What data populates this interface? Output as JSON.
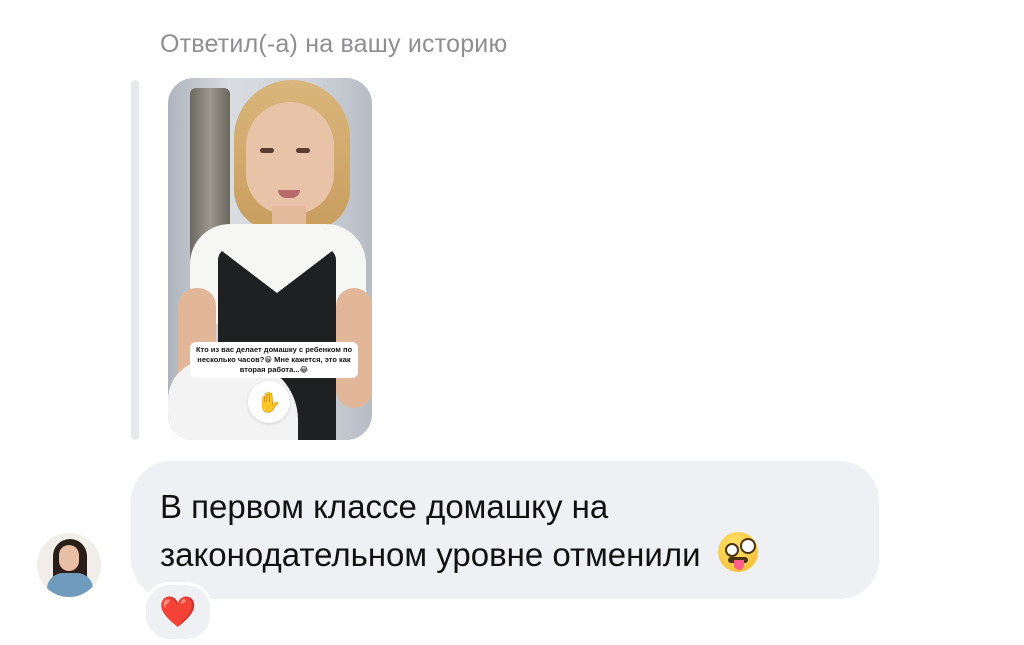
{
  "reply_header": "Ответил(-а) на вашу историю",
  "story": {
    "caption": "Кто из вас делает домашку с ребенком по несколько часов?😁 Мне кажется, это как вторая работа...😂",
    "reaction_icon": "✋"
  },
  "message": {
    "text": "В первом классе домашку на законодательном уровне отменили",
    "emoji": "zany-face"
  },
  "reaction": {
    "icon": "❤️",
    "color": "#e3243b"
  },
  "colors": {
    "bubble": "#eff0f3",
    "secondary_text": "#8e8e93"
  }
}
